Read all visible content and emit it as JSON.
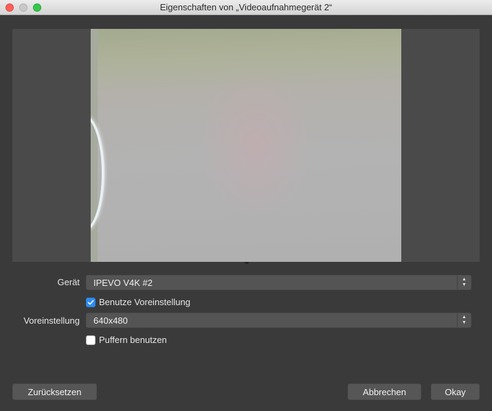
{
  "window": {
    "title": "Eigenschaften von „Videoaufnahmegerät 2“",
    "controls": [
      "close-icon",
      "minimize-icon",
      "zoom-icon"
    ]
  },
  "form": {
    "device_label": "Gerät",
    "device_value": "IPEVO V4K #2",
    "use_preset_label": "Benutze Voreinstellung",
    "use_preset_checked": true,
    "preset_label": "Voreinstellung",
    "preset_value": "640x480",
    "buffering_label": "Puffern benutzen",
    "buffering_checked": false
  },
  "buttons": {
    "reset": "Zurücksetzen",
    "cancel": "Abbrechen",
    "ok": "Okay"
  },
  "colors": {
    "background": "#3a3a3a",
    "preview_bg": "#4a4a4a",
    "checkbox_accent": "#2d8cf0",
    "button_bg": "#565656"
  }
}
